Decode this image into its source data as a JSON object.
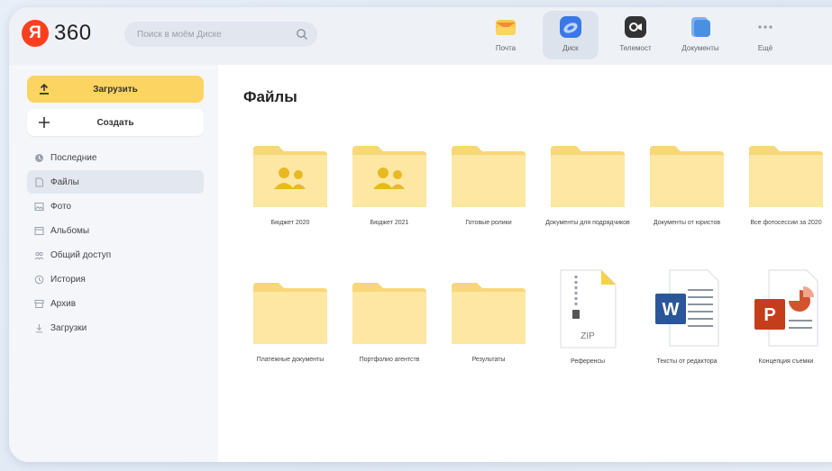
{
  "brand": {
    "badge": "Я",
    "name": "360"
  },
  "search": {
    "placeholder": "Поиск в моём Диске"
  },
  "apps": [
    {
      "label": "Почта",
      "icon": "mail-icon",
      "color": "#f7b52f"
    },
    {
      "label": "Диск",
      "icon": "disk-icon",
      "color": "#3b78e7"
    },
    {
      "label": "Телемост",
      "icon": "telemost-icon",
      "color": "#333333"
    },
    {
      "label": "Документы",
      "icon": "documents-icon",
      "color": "#4a90e2"
    },
    {
      "label": "Ещё",
      "icon": "more-icon",
      "color": "#999999"
    }
  ],
  "sidebar": {
    "upload_label": "Загрузить",
    "create_label": "Создать",
    "items": [
      {
        "label": "Последние",
        "icon": "clock-icon"
      },
      {
        "label": "Файлы",
        "icon": "file-icon"
      },
      {
        "label": "Фото",
        "icon": "photo-icon"
      },
      {
        "label": "Альбомы",
        "icon": "album-icon"
      },
      {
        "label": "Общий доступ",
        "icon": "share-icon"
      },
      {
        "label": "История",
        "icon": "history-icon"
      },
      {
        "label": "Архив",
        "icon": "archive-icon"
      },
      {
        "label": "Загрузки",
        "icon": "download-icon"
      }
    ]
  },
  "main": {
    "title": "Файлы",
    "files": [
      {
        "name": "Бюджет 2020",
        "type": "shared-folder"
      },
      {
        "name": "Бюджет 2021",
        "type": "shared-folder"
      },
      {
        "name": "Готовые ролики",
        "type": "folder"
      },
      {
        "name": "Документы для подрядчиков",
        "type": "folder"
      },
      {
        "name": "Документы от юристов",
        "type": "folder"
      },
      {
        "name": "Все фотосессии за 2020",
        "type": "folder"
      },
      {
        "name": "Платежные документы",
        "type": "folder"
      },
      {
        "name": "Портфолио агентств",
        "type": "folder"
      },
      {
        "name": "Результаты",
        "type": "folder"
      },
      {
        "name": "Референсы",
        "type": "zip"
      },
      {
        "name": "Тексты от редактора",
        "type": "word"
      },
      {
        "name": "Концепция съемки",
        "type": "powerpoint"
      }
    ]
  },
  "colors": {
    "accent": "#fbd461",
    "folder": "#fde7a3",
    "folder_dark": "#f8d779"
  }
}
